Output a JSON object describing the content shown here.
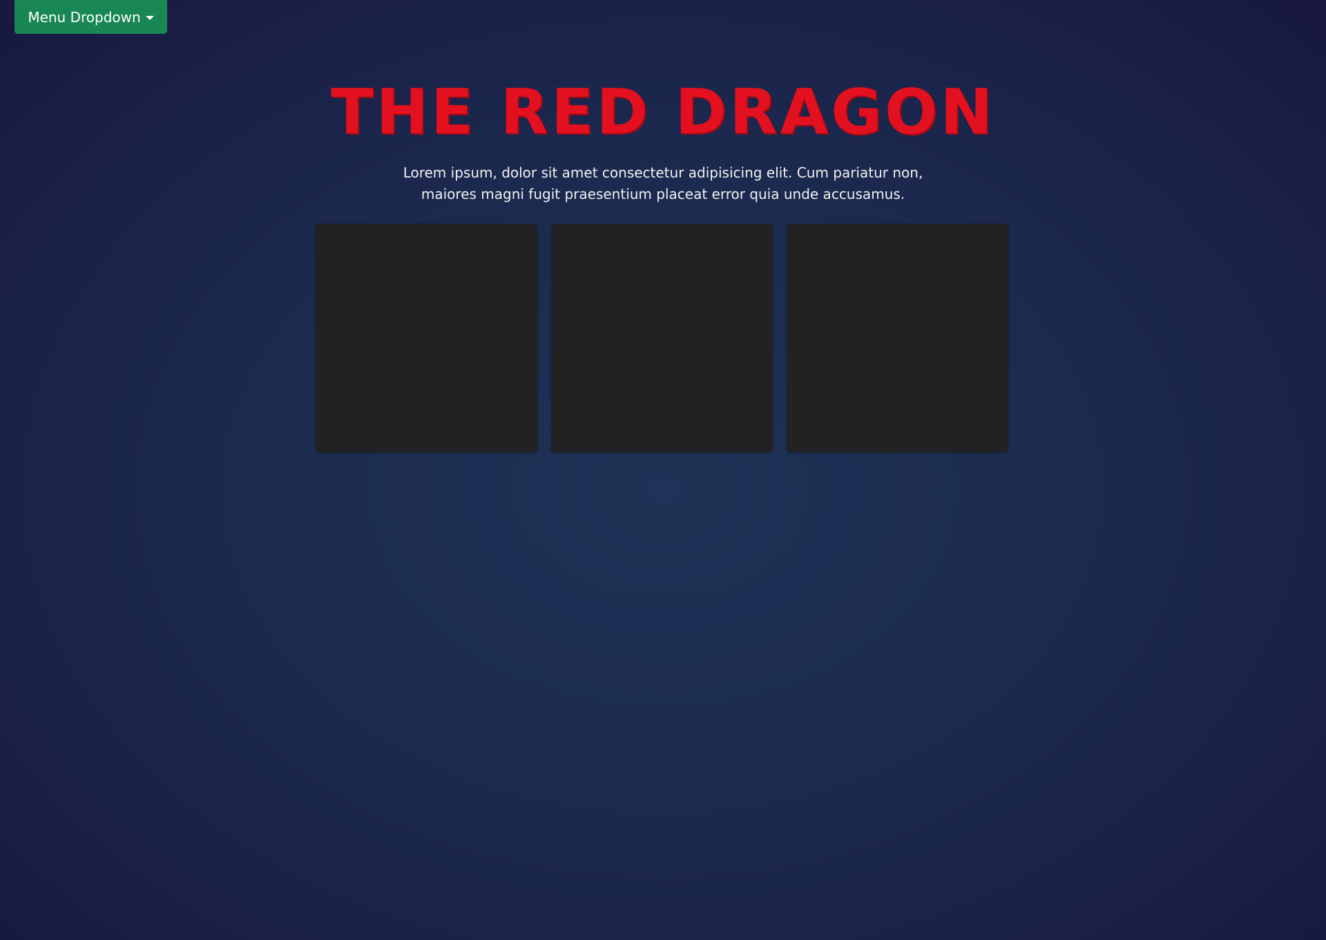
{
  "menu": {
    "label": "Menu Dropdown",
    "color": "#198754"
  },
  "hero": {
    "title": "THE RED DRAGON",
    "title_color": "#e3101f",
    "lead": "Lorem ipsum, dolor sit amet consectetur adipisicing elit. Cum pariatur non, maiores magni fugit praesentium placeat error quia unde accusamus."
  },
  "cards": [
    {
      "id": "card-1"
    },
    {
      "id": "card-2"
    },
    {
      "id": "card-3"
    }
  ]
}
